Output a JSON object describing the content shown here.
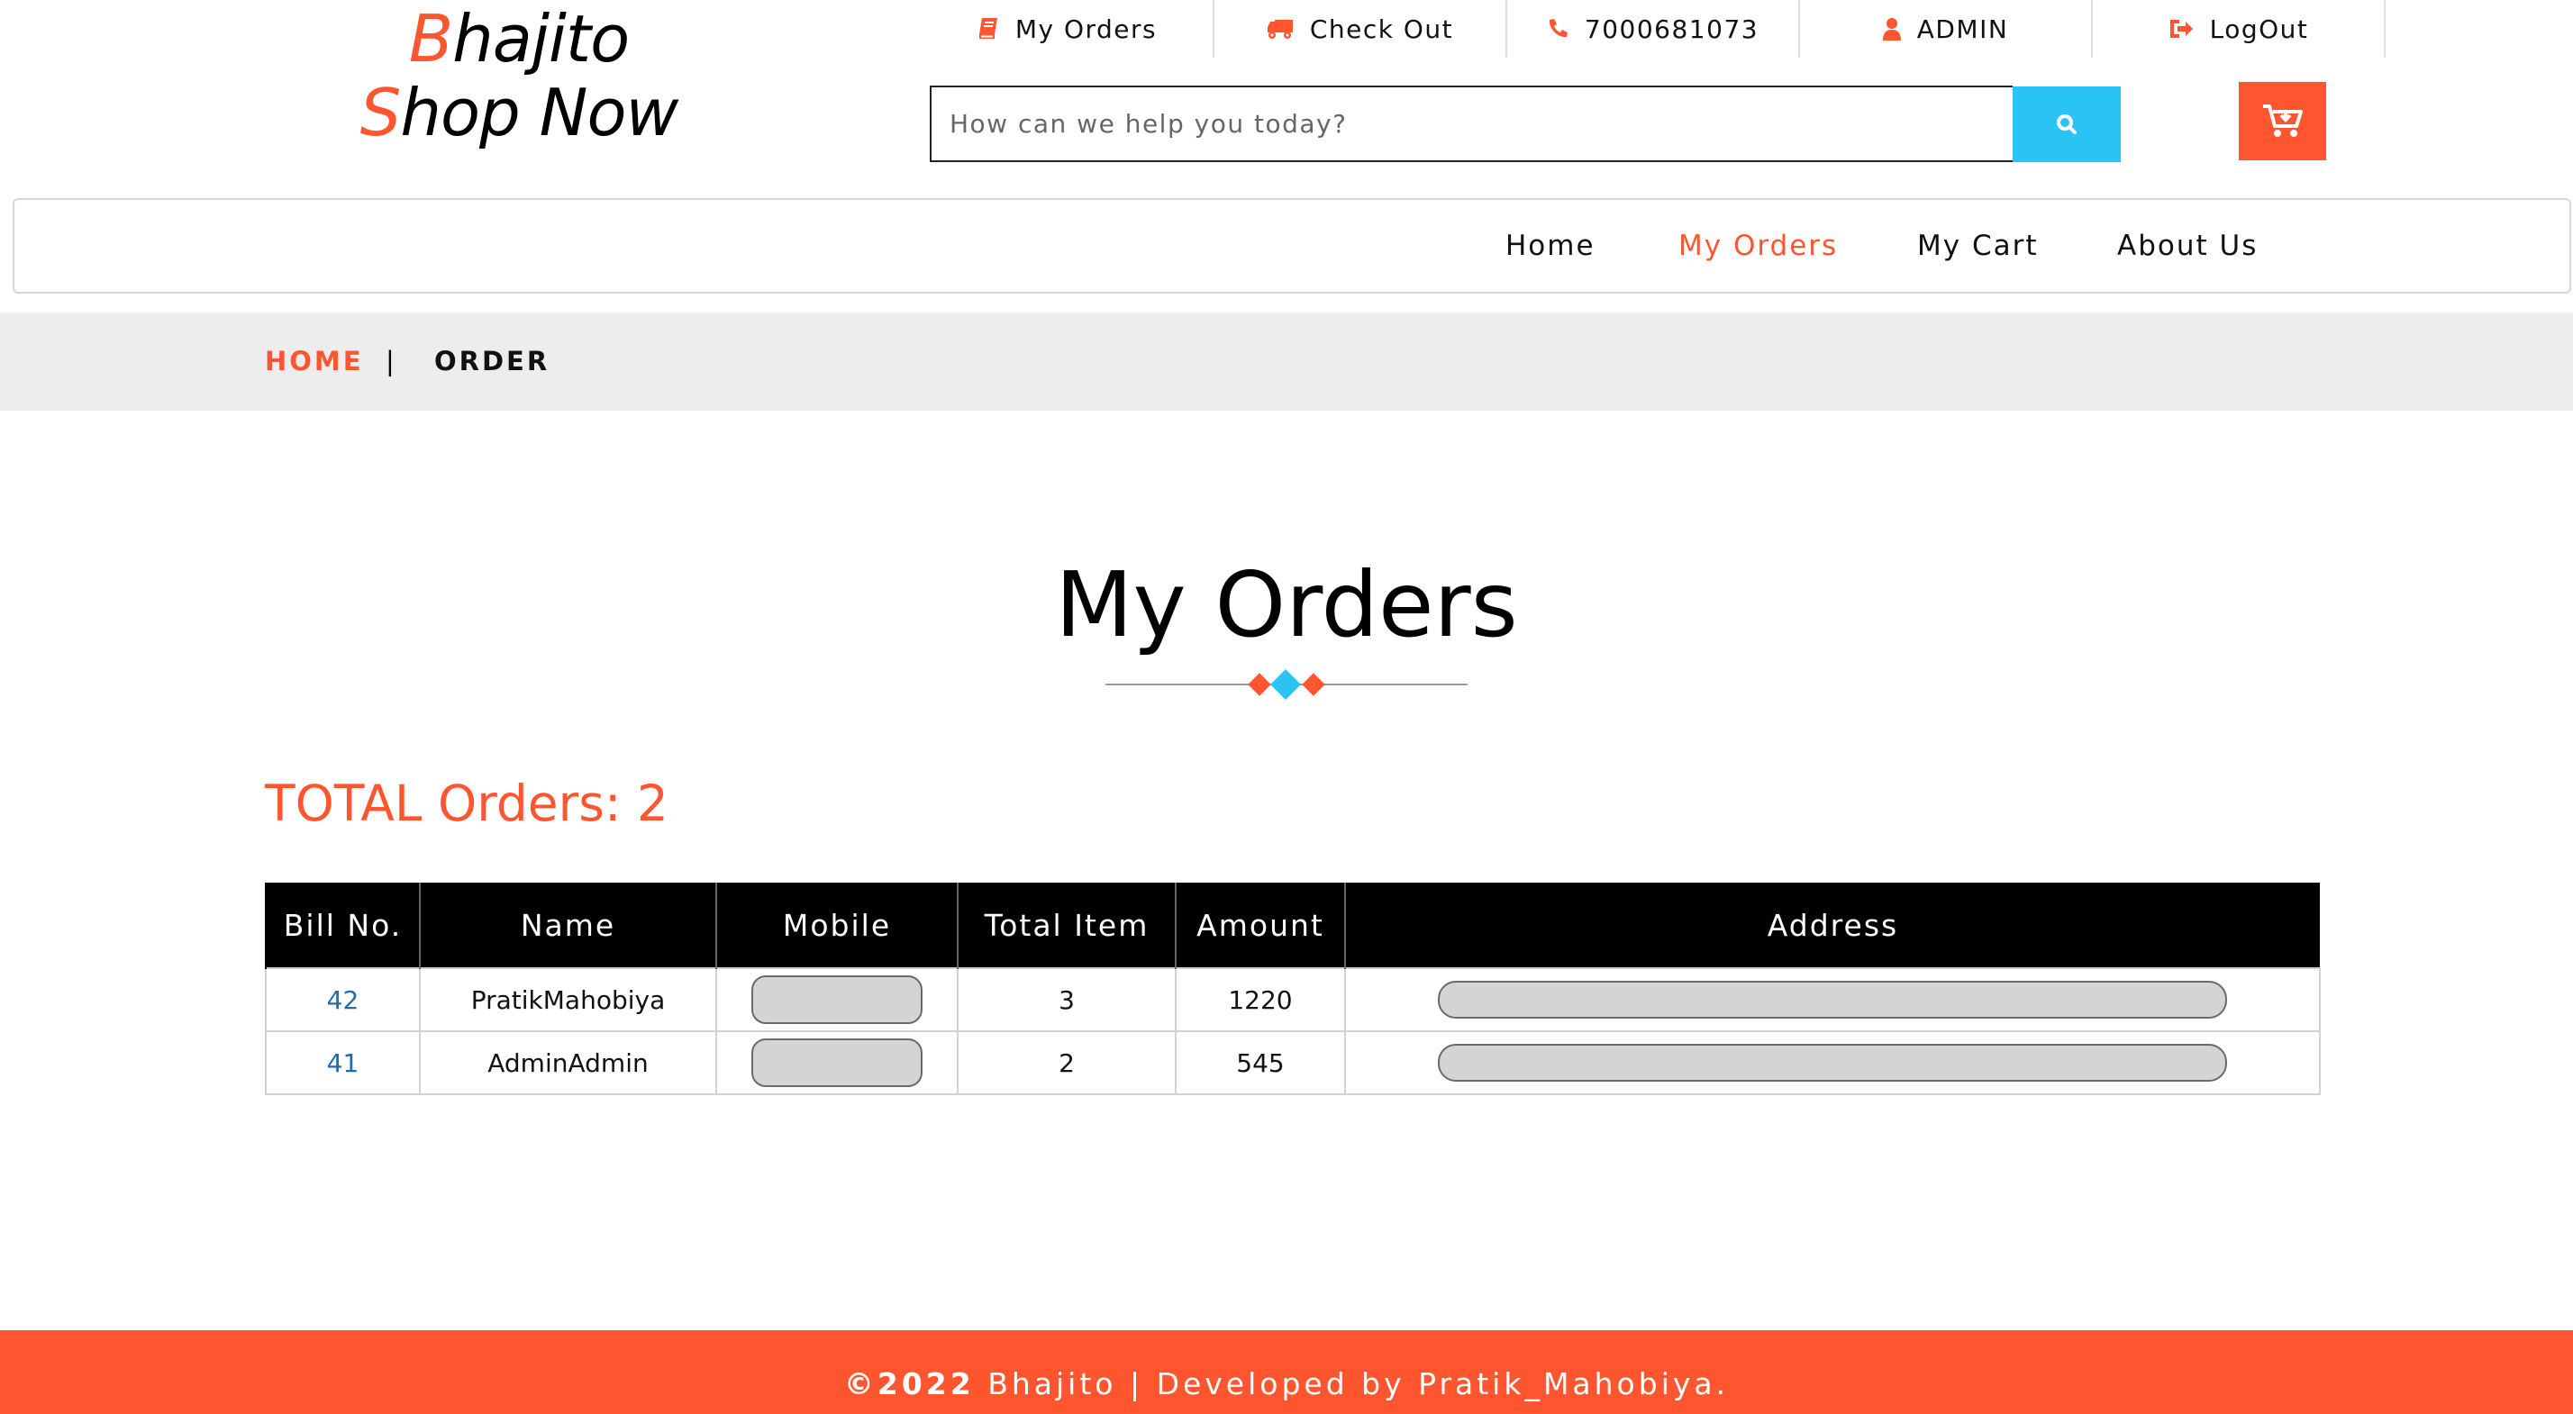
{
  "logo": {
    "line1_cap": "B",
    "line1_rest": "hajito",
    "line2_cap": "S",
    "line2_rest": "hop Now"
  },
  "topbar": {
    "items": [
      {
        "label": "My Orders",
        "icon": "book-icon"
      },
      {
        "label": "Check Out",
        "icon": "truck-icon"
      },
      {
        "label": "7000681073",
        "icon": "phone-icon"
      },
      {
        "label": "ADMIN",
        "icon": "user-icon"
      },
      {
        "label": "LogOut",
        "icon": "sign-out-icon"
      }
    ]
  },
  "search": {
    "placeholder": "How can we help you today?",
    "value": "",
    "button_icon": "search-icon"
  },
  "cart_button": {
    "icon": "cart-icon"
  },
  "nav": {
    "items": [
      {
        "label": "Home",
        "active": false
      },
      {
        "label": "My Orders",
        "active": true
      },
      {
        "label": "My Cart",
        "active": false
      },
      {
        "label": "About Us",
        "active": false
      }
    ]
  },
  "breadcrumb": {
    "home": "HOME",
    "separator": "|",
    "current": "ORDER"
  },
  "main": {
    "title": "My Orders",
    "total_label": "TOTAL Orders: 2"
  },
  "table": {
    "headers": [
      "Bill No.",
      "Name",
      "Mobile",
      "Total Item",
      "Amount",
      "Address"
    ],
    "rows": [
      {
        "bill_no": "42",
        "name": "PratikMahobiya",
        "total_item": "3",
        "amount": "1220"
      },
      {
        "bill_no": "41",
        "name": "AdminAdmin",
        "total_item": "2",
        "amount": "545"
      }
    ]
  },
  "footer": {
    "copyright": "©2022",
    "text": " Bhajito | Developed by Pratik_Mahobiya."
  },
  "colors": {
    "accent": "#ff5630",
    "search_button": "#29c4f4",
    "link": "#1f6bb0",
    "breadcrumb_bg": "#ededed"
  }
}
